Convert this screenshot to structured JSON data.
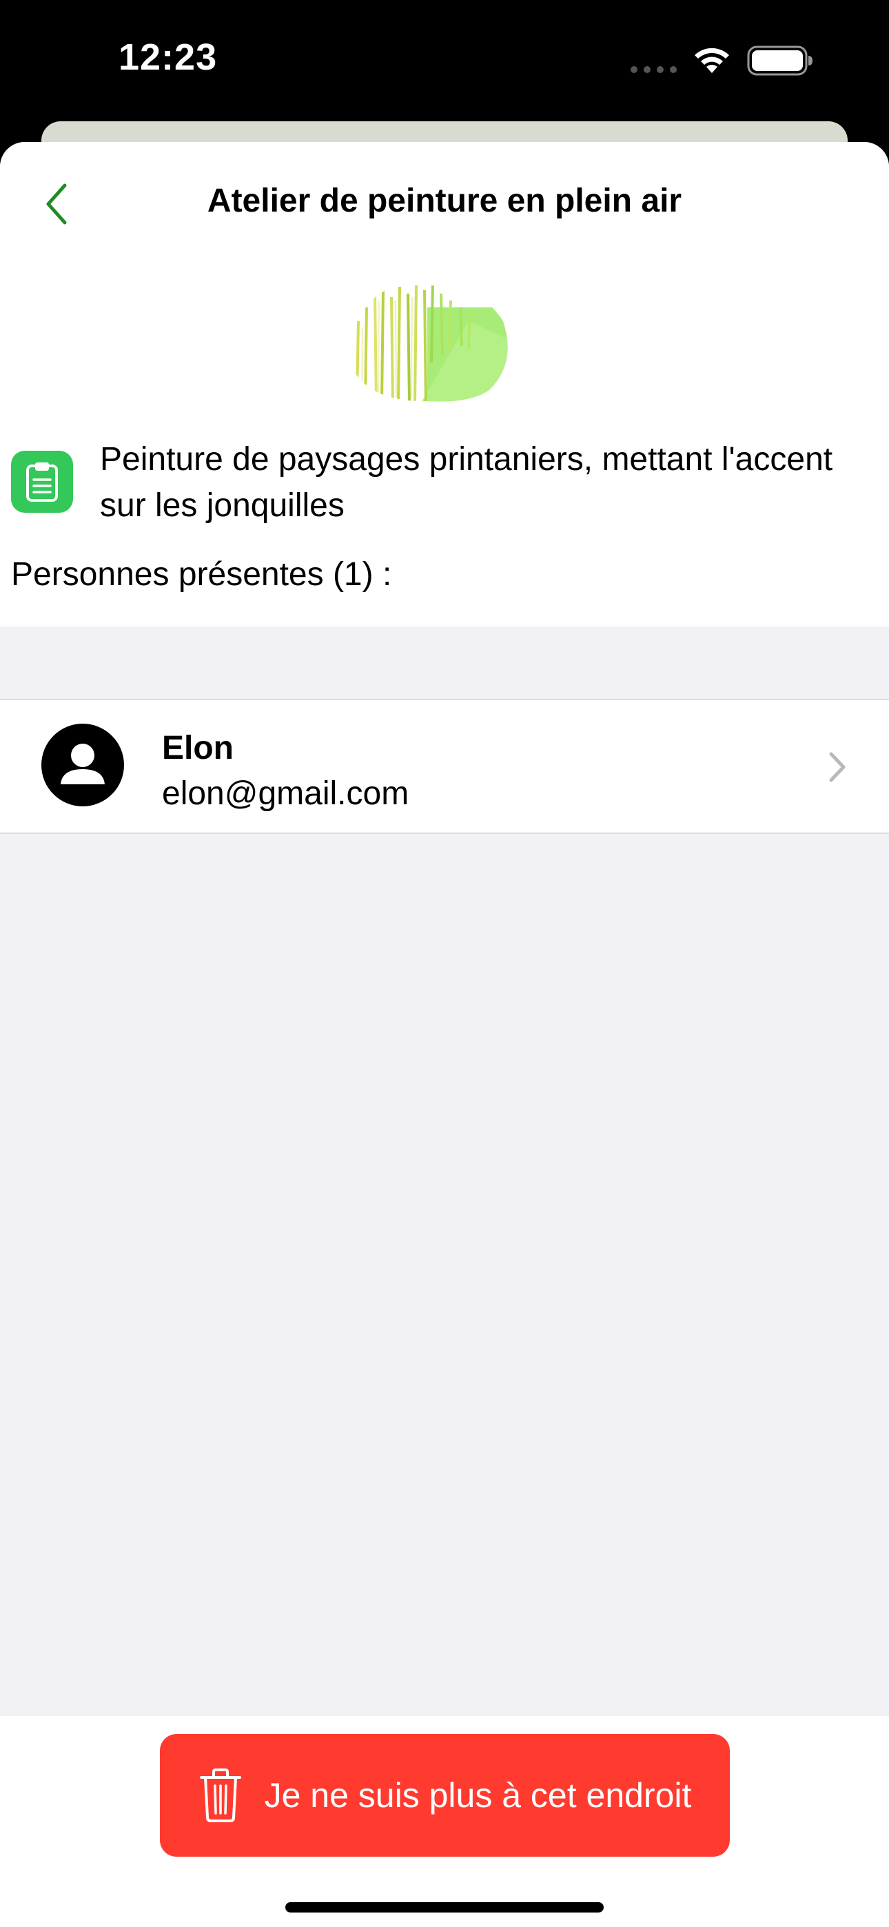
{
  "status_bar": {
    "time": "12:23"
  },
  "nav": {
    "back_icon": "chevron-left-icon",
    "title": "Atelier de peinture en plein air",
    "accent_color": "#1f8b24"
  },
  "event": {
    "image_icon": "daffodil-painting-image",
    "description_icon": "clipboard-icon",
    "description": "Peinture de paysages printaniers, mettant l'accent sur les jonquilles",
    "attendees_label": "Personnes présentes (1) :"
  },
  "attendees": [
    {
      "name": "Elon",
      "email": "elon@gmail.com",
      "avatar_icon": "person-circle-icon"
    }
  ],
  "actions": {
    "leave_label": "Je ne suis plus à cet endroit",
    "leave_icon": "trash-icon",
    "leave_color": "#ff3b30"
  }
}
